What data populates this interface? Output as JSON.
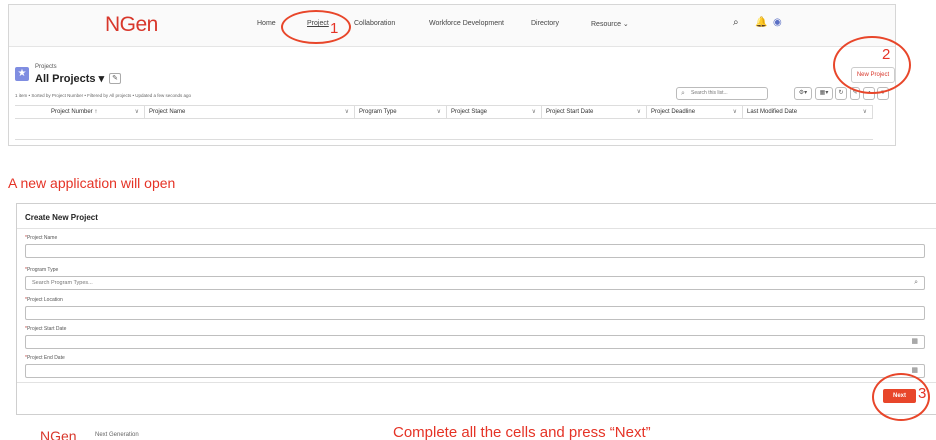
{
  "app": {
    "logo": "NGen",
    "nav": [
      "Home",
      "Project",
      "Collaboration",
      "Workforce Development",
      "Directory",
      "Resource"
    ],
    "active_nav": "Project"
  },
  "list_view": {
    "object_type": "Projects",
    "title": "All Projects",
    "meta": "1 item • Sorted by Project Number • Filtered by All projects • Updated a few seconds ago",
    "search_placeholder": "Search this list...",
    "new_button": "New Project",
    "columns": [
      "Project Number",
      "Project Name",
      "Program Type",
      "Project Stage",
      "Project Start Date",
      "Project Deadline",
      "Last Modified Date"
    ]
  },
  "annotations": {
    "step1": "1",
    "step2": "2",
    "step3": "3",
    "intro": "A new application will open",
    "footer_note": "Complete all the cells and press “Next”"
  },
  "form": {
    "title": "Create New Project",
    "fields": [
      {
        "label": "Project Name",
        "placeholder": ""
      },
      {
        "label": "Program Type",
        "placeholder": "Search Program Types..."
      },
      {
        "label": "Project Location",
        "placeholder": ""
      },
      {
        "label": "Project Start Date",
        "placeholder": ""
      },
      {
        "label": "Project End Date",
        "placeholder": ""
      }
    ],
    "next_label": "Next",
    "required_marker": "*"
  },
  "footer": {
    "logo": "NGen",
    "tagline": "Next Generation"
  },
  "colors": {
    "accent": "#e8462a",
    "brand": "#d8372b",
    "object_icon": "#7f8de1"
  },
  "icons": [
    "search-icon",
    "bell-icon",
    "user-avatar-icon",
    "pin-icon",
    "settings-icon",
    "table-view-icon",
    "refresh-icon",
    "chart-icon",
    "filter-icon",
    "calendar-icon",
    "chevron-down-icon"
  ]
}
